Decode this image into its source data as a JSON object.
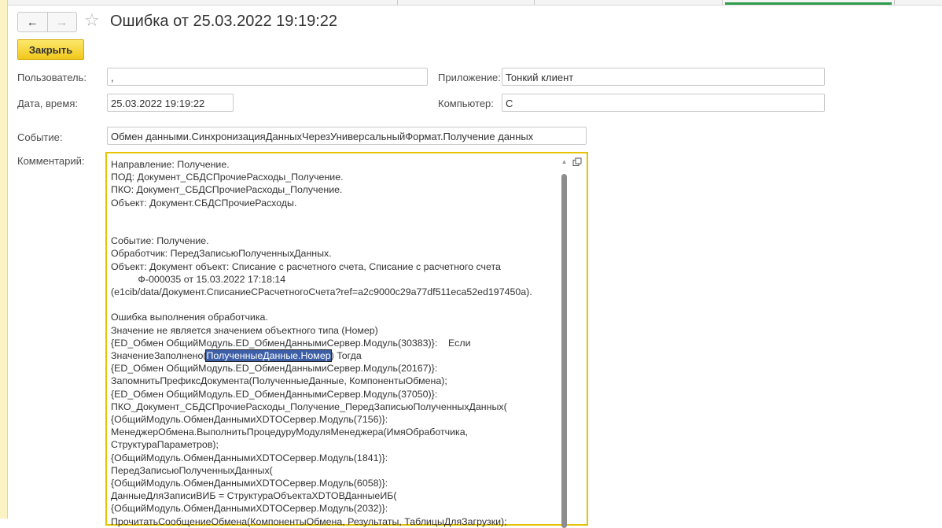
{
  "window": {
    "title": "Ошибка от 25.03.2022 19:19:22",
    "back_icon": "←",
    "forward_icon": "→",
    "star_icon": "☆"
  },
  "toolbar": {
    "close_label": "Закрыть"
  },
  "form": {
    "user_label": "Пользователь:",
    "user_value": ",",
    "app_label": "Приложение:",
    "app_value": "Тонкий клиент",
    "date_label": "Дата, время:",
    "date_value": "25.03.2022 19:19:22",
    "computer_label": "Компьютер:",
    "computer_value": "С",
    "event_label": "Событие:",
    "event_value": "Обмен данными.СинхронизацияДанныхЧерезУниверсальныйФормат.Получение данных",
    "comment_label": "Комментарий:"
  },
  "comment": {
    "before_highlight": "Направление: Получение.\nПОД: Документ_СБДСПрочиеРасходы_Получение.\nПКО: Документ_СБДСПрочиеРасходы_Получение.\nОбъект: Документ.СБДСПрочиеРасходы.\n\n\nСобытие: Получение.\nОбработчик: ПередЗаписьюПолученныхДанных.\nОбъект: Документ объект: Списание с расчетного счета, Списание с расчетного счета\n          Ф-000035 от 15.03.2022 17:18:14\n(e1cib/data/Документ.СписаниеСРасчетногоСчета?ref=a2c9000c29a77df511eca52ed197450a).\n\nОшибка выполнения обработчика.\nЗначение не является значением объектного типа (Номер)\n{ED_Обмен ОбщийМодуль.ED_ОбменДаннымиСервер.Модуль(30383)}:    Если\nЗначениеЗаполнено(",
    "highlight": "ПолученныеДанные.Номер",
    "after_highlight": ") Тогда\n{ED_Обмен ОбщийМодуль.ED_ОбменДаннымиСервер.Модуль(20167)}:\nЗапомнитьПрефиксДокумента(ПолученныеДанные, КомпонентыОбмена);\n{ED_Обмен ОбщийМодуль.ED_ОбменДаннымиСервер.Модуль(37050)}:\nПКО_Документ_СБДСПрочиеРасходы_Получение_ПередЗаписьюПолученныхДанных(\n{ОбщийМодуль.ОбменДаннымиXDTOСервер.Модуль(7156)}:\nМенеджерОбмена.ВыполнитьПроцедуруМодуляМенеджера(ИмяОбработчика,\nСтруктураПараметров);\n{ОбщийМодуль.ОбменДаннымиXDTOСервер.Модуль(1841)}:\nПередЗаписьюПолученныхДанных(\n{ОбщийМодуль.ОбменДаннымиXDTOСервер.Модуль(6058)}:\nДанныеДляЗаписиВИБ = СтруктураОбъектаXDTOВДанныеИБ(\n{ОбщийМодуль.ОбменДаннымиXDTOСервер.Модуль(2032)}:\nПрочитатьСообщениеОбмена(КомпонентыОбмена, Результаты, ТаблицыДляЗагрузки);"
  }
}
